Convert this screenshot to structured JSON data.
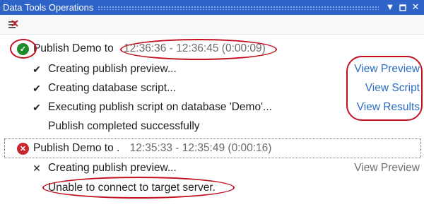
{
  "window": {
    "title": "Data Tools Operations",
    "buttons": [
      "pin-icon",
      "restore-icon",
      "close-icon"
    ]
  },
  "toolbar": {
    "clear_icon": "clear-list-icon"
  },
  "operations": [
    {
      "status": "success",
      "title": "Publish Demo to ",
      "time": "12:36:36 - 12:36:45 (0:00:09)",
      "steps": [
        {
          "icon": "checkmark-icon",
          "text": "Creating publish preview...",
          "link": "View Preview",
          "link_enabled": true
        },
        {
          "icon": "checkmark-icon",
          "text": "Creating database script...",
          "link": "View Script",
          "link_enabled": true
        },
        {
          "icon": "checkmark-icon",
          "text": "Executing publish script on database 'Demo'...",
          "link": "View Results",
          "link_enabled": true
        },
        {
          "icon": "",
          "text": "Publish completed successfully",
          "link": "",
          "link_enabled": false
        }
      ]
    },
    {
      "status": "error",
      "title": "Publish Demo to . ",
      "time": "12:35:33 - 12:35:49 (0:00:16)",
      "steps": [
        {
          "icon": "x-icon",
          "text": "Creating publish preview...",
          "link": "View Preview",
          "link_enabled": false
        }
      ],
      "error": "Unable to connect to target server."
    }
  ],
  "colors": {
    "titlebar": "#2e64c8",
    "link": "#2a6cc0",
    "annotation": "#c0121f",
    "success": "#1e8a2a",
    "error": "#c8262a"
  }
}
